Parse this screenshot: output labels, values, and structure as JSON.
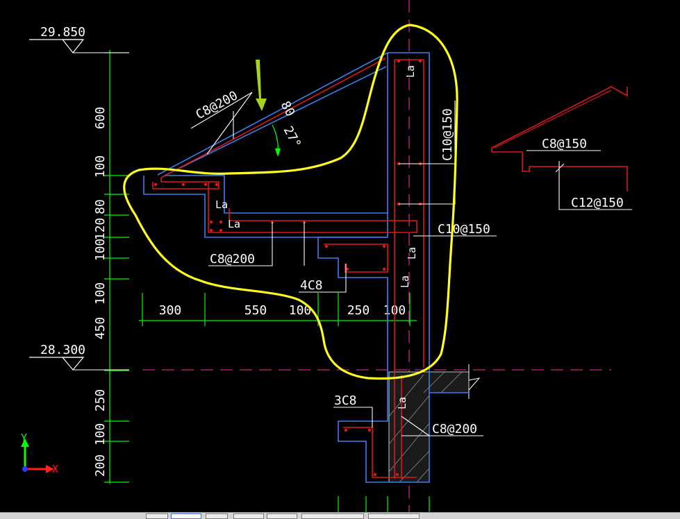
{
  "elevations": {
    "top": "29.850",
    "bottom": "28.300"
  },
  "vertical_dims": [
    "600",
    "100",
    "80",
    "120",
    "100",
    "100",
    "450",
    "250",
    "100",
    "200"
  ],
  "horizontal_dims": [
    "300",
    "550",
    "100",
    "250",
    "100"
  ],
  "labels": {
    "rebar_top_slab": "C8@200",
    "thickness": "80",
    "angle": "27°",
    "wall_vertical": "C10@150",
    "wall_horizontal": "C10@150",
    "lower_slab": "C8@200",
    "bars_4": "4C8",
    "bars_3": "3C8",
    "bottom_beam": "C8@200",
    "detail_top": "C8@150",
    "detail_bottom": "C12@150",
    "anchor": "La"
  },
  "ucs": {
    "x": "X",
    "y": "Y"
  },
  "colors": {
    "background": "#000000",
    "dimension": "#00ff00",
    "concrete_outline": "#3a7ff0",
    "rebar": "#e01818",
    "text": "#ffffff",
    "highlight": "#ffff20",
    "axis": "#d0208f",
    "arrow": "#a6d41e"
  },
  "status_tabs": [
    "",
    "",
    "",
    "",
    "",
    "",
    ""
  ]
}
